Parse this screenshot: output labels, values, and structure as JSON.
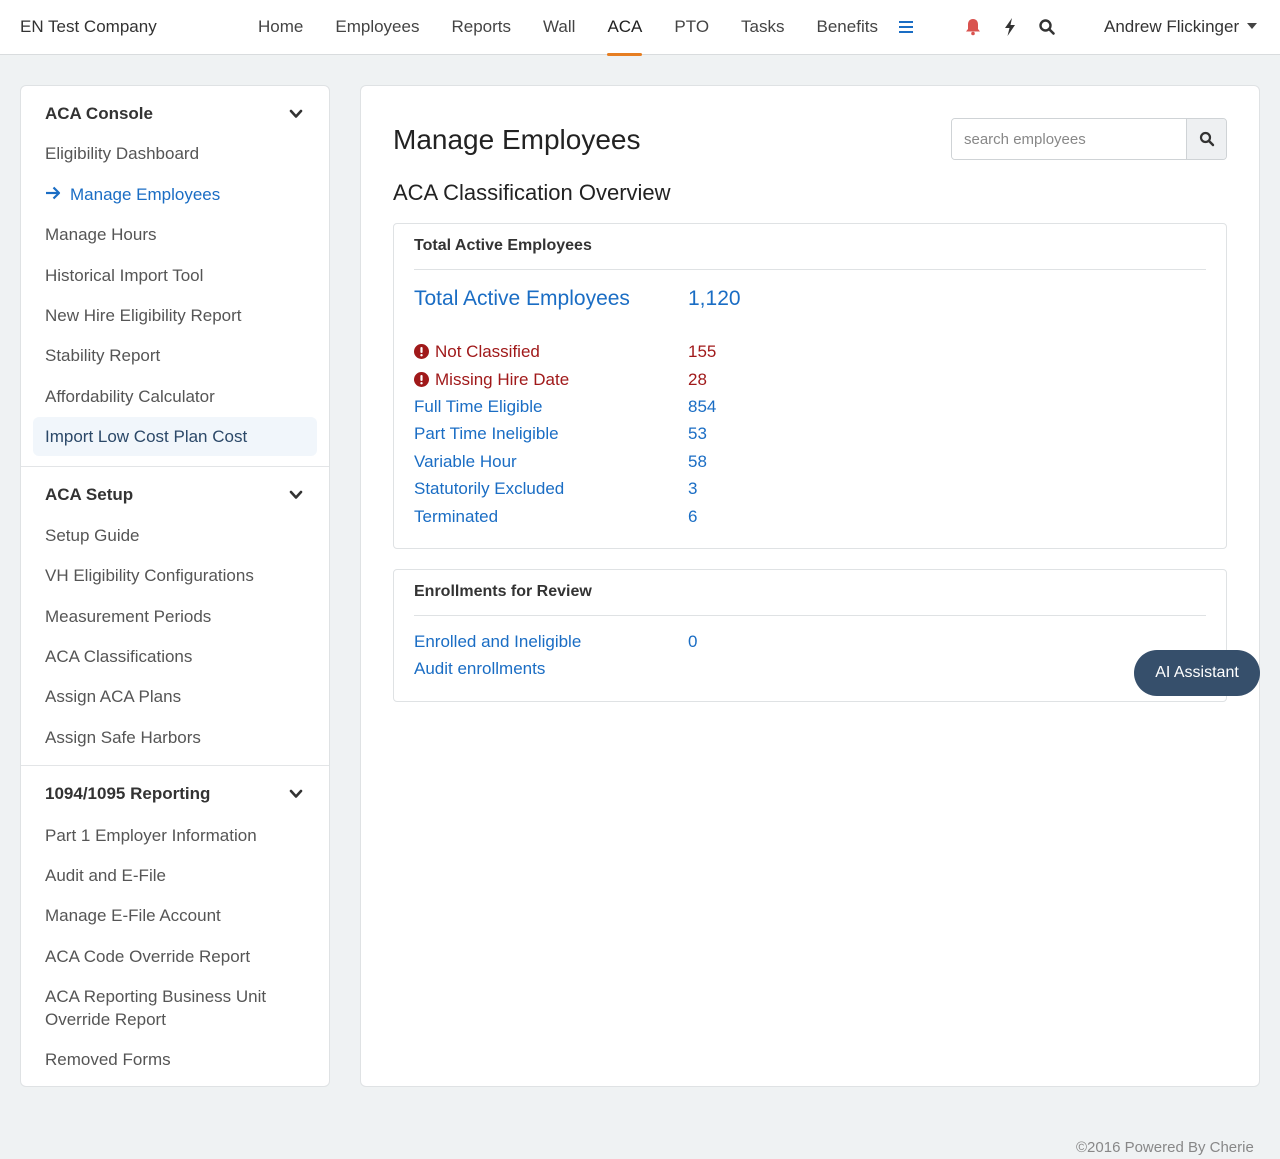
{
  "header": {
    "company": "EN Test Company",
    "nav": [
      {
        "label": "Home",
        "active": false
      },
      {
        "label": "Employees",
        "active": false
      },
      {
        "label": "Reports",
        "active": false
      },
      {
        "label": "Wall",
        "active": false
      },
      {
        "label": "ACA",
        "active": true
      },
      {
        "label": "PTO",
        "active": false
      },
      {
        "label": "Tasks",
        "active": false
      },
      {
        "label": "Benefits",
        "active": false
      }
    ],
    "icons": [
      "menu-icon",
      "bell-icon",
      "bolt-icon",
      "search-icon"
    ],
    "user": "Andrew Flickinger"
  },
  "sidebar": {
    "sections": [
      {
        "title": "ACA Console",
        "items": [
          "Eligibility Dashboard",
          "Manage Employees",
          "Manage Hours",
          "Historical Import Tool",
          "New Hire Eligibility Report",
          "Stability Report",
          "Affordability Calculator",
          "Import Low Cost Plan Cost"
        ]
      },
      {
        "title": "ACA Setup",
        "items": [
          "Setup Guide",
          "VH Eligibility Configurations",
          "Measurement Periods",
          "ACA Classifications",
          "Assign ACA Plans",
          "Assign Safe Harbors"
        ]
      },
      {
        "title": "1094/1095 Reporting",
        "items": [
          "Part 1 Employer Information",
          "Audit and E-File",
          "Manage E-File Account",
          "ACA Code Override Report",
          "ACA Reporting Business Unit",
          "Override Report",
          "Removed Forms"
        ]
      }
    ],
    "current_item": "Manage Employees"
  },
  "main": {
    "title": "Manage Employees",
    "search_placeholder": "search employees",
    "section_title": "ACA Classification Overview",
    "active_card": {
      "header": "Total Active Employees",
      "total_label": "Total Active Employees",
      "total_value": "1,120",
      "rows": [
        {
          "label": "Not Classified",
          "value": "155",
          "warning": true
        },
        {
          "label": "Missing Hire Date",
          "value": "28",
          "warning": true
        },
        {
          "label": "Full Time Eligible",
          "value": "854",
          "warning": false
        },
        {
          "label": "Part Time Ineligible",
          "value": "53",
          "warning": false
        },
        {
          "label": "Variable Hour",
          "value": "58",
          "warning": false
        },
        {
          "label": "Statutorily Excluded",
          "value": "3",
          "warning": false
        },
        {
          "label": "Terminated",
          "value": "6",
          "warning": false
        }
      ]
    },
    "review_card": {
      "header": "Enrollments for Review",
      "rows": [
        {
          "label": "Enrolled and Ineligible",
          "value": "0"
        },
        {
          "label": "Audit enrollments",
          "value": ""
        }
      ]
    }
  },
  "ai_assistant": "AI Assistant",
  "footer": "©2016 Powered By Cherie",
  "colors": {
    "accent": "#e67e22",
    "link": "#1a6dc4",
    "warning": "#a0191a",
    "bell": "#d9534f",
    "ai_button": "#364f6b"
  }
}
